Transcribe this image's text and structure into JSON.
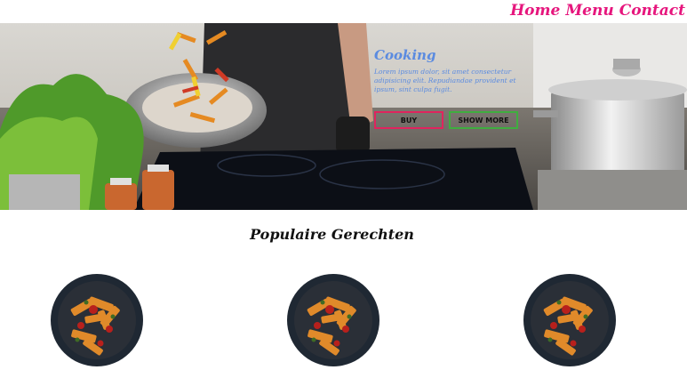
{
  "nav": {
    "items": [
      {
        "label": "Home"
      },
      {
        "label": "Menu"
      },
      {
        "label": "Contact"
      }
    ]
  },
  "hero": {
    "title": "Cooking",
    "body": "Lorem ipsum dolor, sit amet consectetur adipisicing elit. Repudiandae provident et ipsum, sint culpa fugit.",
    "buttons": {
      "buy": "BUY",
      "more": "SHOW MORE"
    },
    "colors": {
      "text": "#5b8be0",
      "buy_border": "#e0245e",
      "more_border": "#3fae3f"
    }
  },
  "section": {
    "title": "Populaire Gerechten"
  },
  "dishes": [
    {
      "icon": "pasta-dish-image"
    },
    {
      "icon": "pasta-dish-image"
    },
    {
      "icon": "pasta-dish-image"
    }
  ],
  "colors": {
    "nav_link": "#e6167d"
  }
}
